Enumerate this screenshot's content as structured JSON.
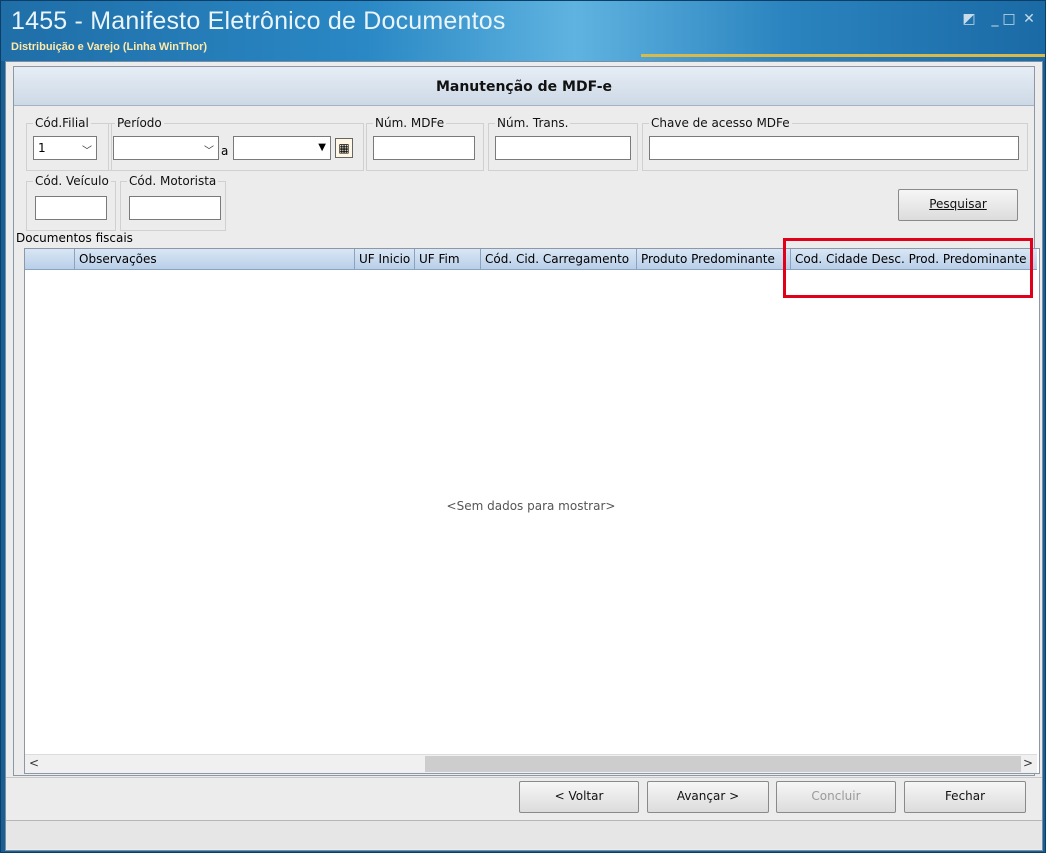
{
  "window": {
    "title": "1455 - Manifesto Eletrônico de Documentos",
    "subtitle": "Distribuição e Varejo (Linha WinThor)"
  },
  "form": {
    "header": "Manutenção de MDF-e",
    "filial_label": "Cód.Filial",
    "filial_value": "1",
    "periodo_label": "Período",
    "periodo_sep": "a",
    "num_mdfe_label": "Núm. MDFe",
    "num_trans_label": "Núm. Trans.",
    "chave_label": "Chave de acesso MDFe",
    "veiculo_label": "Cód. Veículo",
    "motorista_label": "Cód. Motorista",
    "pesquisar": "Pesquisar"
  },
  "grid": {
    "section_label": "Documentos fiscais",
    "columns": [
      "Observações",
      "UF Inicio",
      "UF Fim",
      "Cód. Cid. Carregamento",
      "Produto Predominante",
      "Cod. Cidade Desc. Prod. Predominante"
    ],
    "empty_text": "<Sem dados para mostrar>"
  },
  "buttons": {
    "voltar": "< Voltar",
    "avancar": "Avançar >",
    "concluir": "Concluir",
    "fechar": "Fechar"
  },
  "colors": {
    "highlight": "#e0001a",
    "titlebar": "#1f6ea8"
  }
}
